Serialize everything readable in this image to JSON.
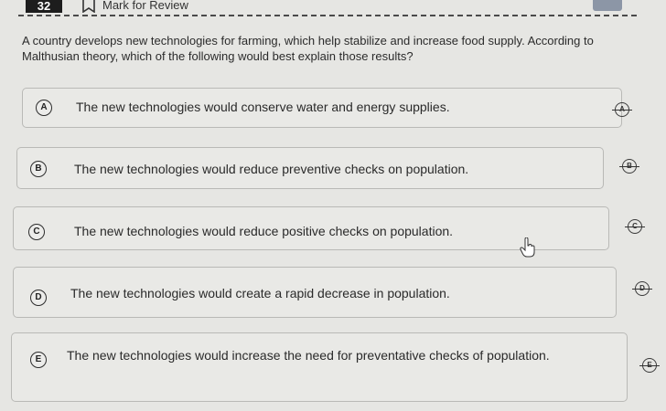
{
  "header": {
    "question_number": "32",
    "mark_for_review": "Mark for Review"
  },
  "question": {
    "text": "A country develops new technologies for farming, which help stabilize and increase food supply. According to Malthusian theory, which of the following would best explain those results?"
  },
  "choices": [
    {
      "letter": "A",
      "text": "The new technologies would conserve water and energy supplies."
    },
    {
      "letter": "B",
      "text": "The new technologies would reduce preventive checks on population."
    },
    {
      "letter": "C",
      "text": "The new technologies would reduce positive checks on population."
    },
    {
      "letter": "D",
      "text": "The new technologies would create a rapid decrease in population."
    },
    {
      "letter": "E",
      "text": "The new technologies would increase the need for preventative checks of population."
    }
  ]
}
